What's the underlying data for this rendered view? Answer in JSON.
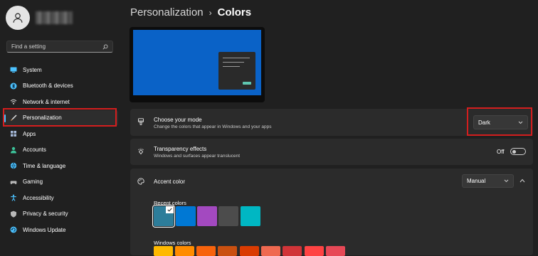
{
  "sidebar": {
    "search_placeholder": "Find a setting",
    "items": [
      {
        "label": "System",
        "icon": "monitor-icon",
        "color": "#4cc2ff"
      },
      {
        "label": "Bluetooth & devices",
        "icon": "bluetooth-icon",
        "color": "#4cc2ff"
      },
      {
        "label": "Network & internet",
        "icon": "wifi-icon",
        "color": "#d8d8d8"
      },
      {
        "label": "Personalization",
        "icon": "brush-icon",
        "color": "#e0a060"
      },
      {
        "label": "Apps",
        "icon": "apps-icon",
        "color": "#a5b8d8"
      },
      {
        "label": "Accounts",
        "icon": "person-icon",
        "color": "#3cc39a"
      },
      {
        "label": "Time & language",
        "icon": "globe-clock-icon",
        "color": "#4cc2ff"
      },
      {
        "label": "Gaming",
        "icon": "controller-icon",
        "color": "#b8b8b8"
      },
      {
        "label": "Accessibility",
        "icon": "accessibility-icon",
        "color": "#4cc2ff"
      },
      {
        "label": "Privacy & security",
        "icon": "shield-icon",
        "color": "#b8b8b8"
      },
      {
        "label": "Windows Update",
        "icon": "update-icon",
        "color": "#4cc2ff"
      }
    ],
    "active_index": 3
  },
  "header": {
    "parent": "Personalization",
    "separator": "›",
    "current": "Colors"
  },
  "mode": {
    "title": "Choose your mode",
    "subtitle": "Change the colors that appear in Windows and your apps",
    "value": "Dark"
  },
  "transparency": {
    "title": "Transparency effects",
    "subtitle": "Windows and surfaces appear translucent",
    "state": "Off"
  },
  "accent": {
    "title": "Accent color",
    "value": "Manual",
    "recent_label": "Recent colors",
    "recent_colors": [
      "#2d7d9a",
      "#0078d4",
      "#a349c0",
      "#4c4c4c",
      "#00b7c3"
    ],
    "windows_label": "Windows colors",
    "windows_colors": [
      "#ffb900",
      "#ff8c00",
      "#f7630c",
      "#ca5010",
      "#da3b01",
      "#ef6950",
      "#d13438",
      "#ff4343",
      "#e74856"
    ]
  },
  "colors": {
    "accent": "#4cc2ff",
    "highlight": "#d41e1e"
  }
}
